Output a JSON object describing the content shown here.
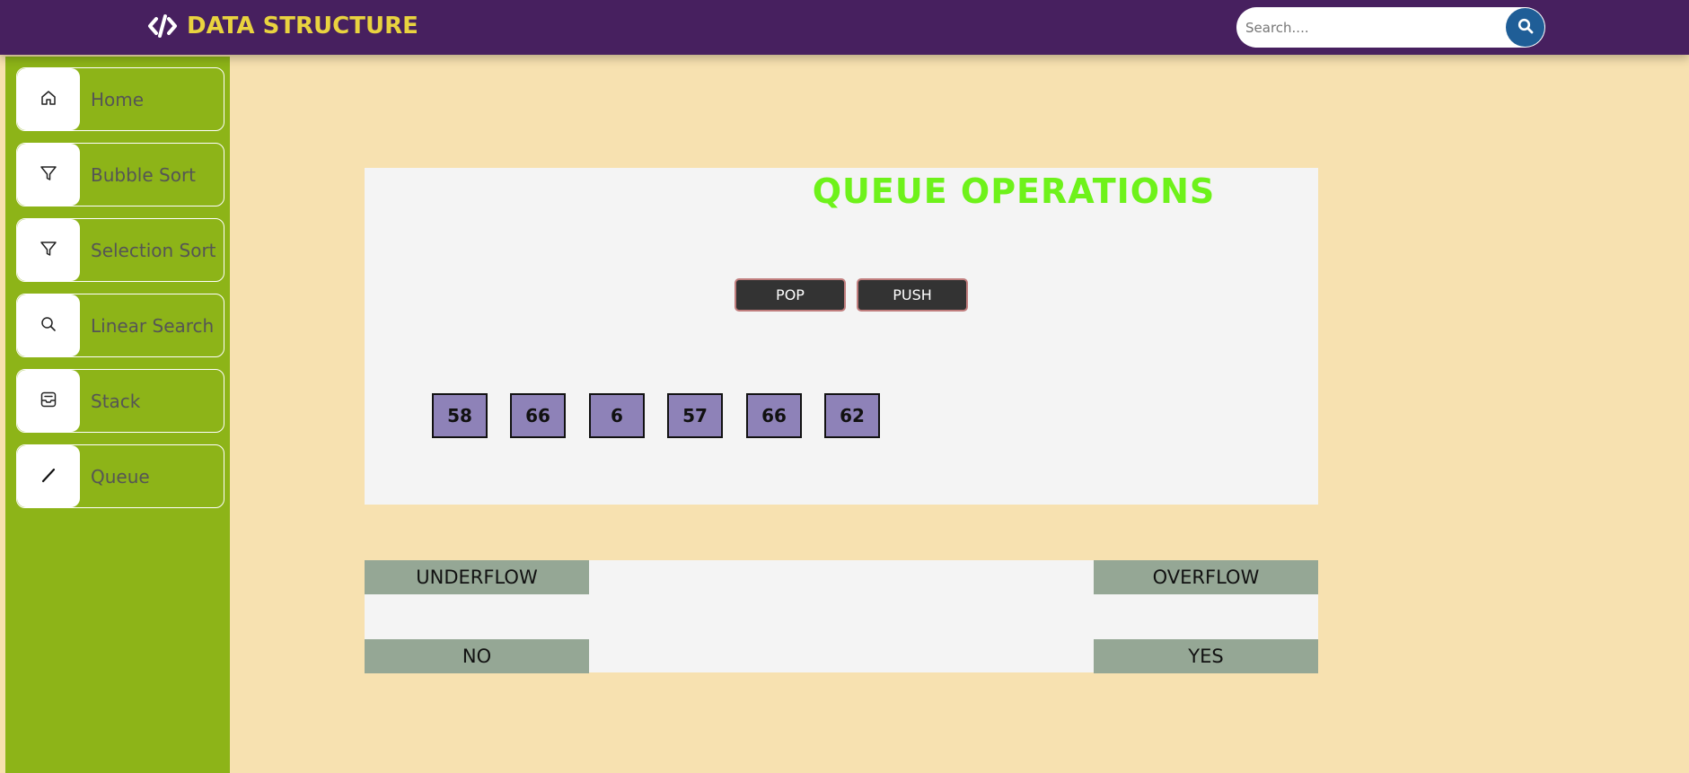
{
  "header": {
    "brand": "DATA STRUCTURE",
    "brand_icon": "code-icon",
    "search_placeholder": "Search....",
    "search_icon": "search-icon"
  },
  "sidebar": {
    "items": [
      {
        "label": "Home",
        "icon": "home-icon"
      },
      {
        "label": "Bubble Sort",
        "icon": "filter-icon"
      },
      {
        "label": "Selection Sort",
        "icon": "filter-icon"
      },
      {
        "label": "Linear Search",
        "icon": "search-icon"
      },
      {
        "label": "Stack",
        "icon": "inbox-icon"
      },
      {
        "label": "Queue",
        "icon": "slash-icon"
      }
    ]
  },
  "main": {
    "title": "QUEUE OPERATIONS",
    "pop_label": "POP",
    "push_label": "PUSH",
    "queue": [
      "58",
      "66",
      "6",
      "57",
      "66",
      "62"
    ],
    "status": {
      "underflow_label": "UNDERFLOW",
      "overflow_label": "OVERFLOW",
      "underflow_value": "NO",
      "overflow_value": "YES"
    }
  },
  "colors": {
    "topbar": "#47205f",
    "brand": "#e9d33f",
    "sidebar": "#8db418",
    "page_bg": "#f7e1b0",
    "title": "#6ef21a",
    "queue_box": "#8e82b8",
    "status_cell": "#95a795",
    "search_button": "#1f5e97"
  }
}
